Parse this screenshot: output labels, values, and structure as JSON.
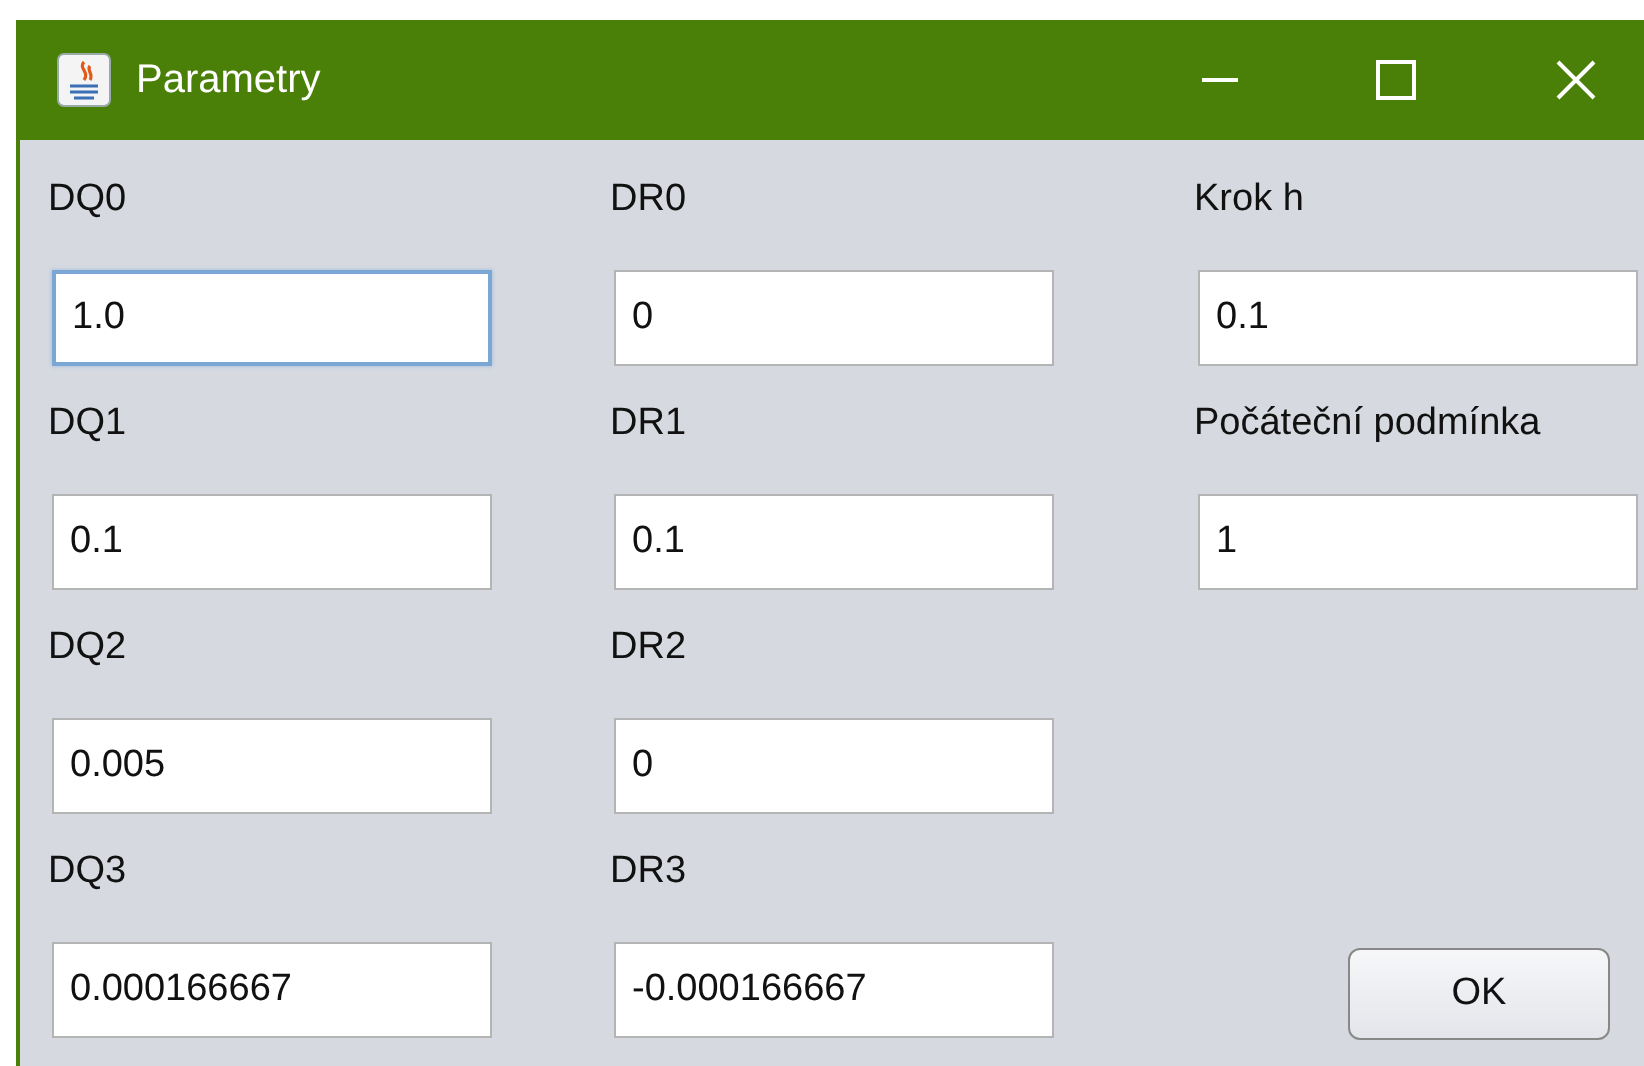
{
  "window": {
    "title": "Parametry"
  },
  "columns": [
    {
      "fields": [
        {
          "label": "DQ0",
          "value": "1.0",
          "focused": true
        },
        {
          "label": "DQ1",
          "value": "0.1",
          "focused": false
        },
        {
          "label": "DQ2",
          "value": "0.005",
          "focused": false
        },
        {
          "label": "DQ3",
          "value": "0.000166667",
          "focused": false
        }
      ]
    },
    {
      "fields": [
        {
          "label": "DR0",
          "value": "0",
          "focused": false
        },
        {
          "label": "DR1",
          "value": "0.1",
          "focused": false
        },
        {
          "label": "DR2",
          "value": "0",
          "focused": false
        },
        {
          "label": "DR3",
          "value": "-0.000166667",
          "focused": false
        }
      ]
    },
    {
      "fields": [
        {
          "label": "Krok h",
          "value": "0.1",
          "focused": false
        },
        {
          "label": "Počáteční podmínka",
          "value": "1",
          "focused": false
        }
      ]
    }
  ],
  "buttons": [
    "OK"
  ]
}
